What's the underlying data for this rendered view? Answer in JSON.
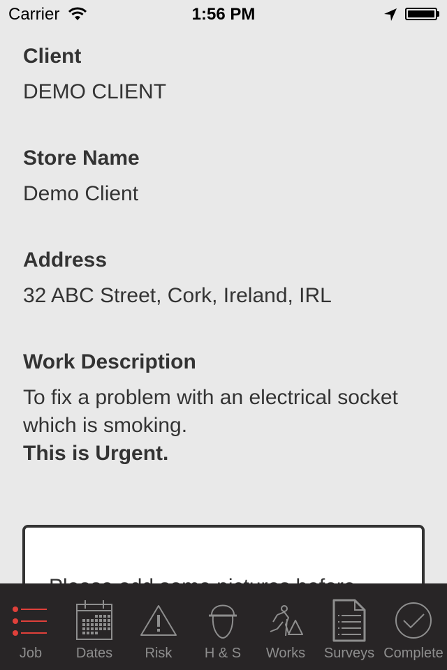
{
  "status_bar": {
    "carrier": "Carrier",
    "time": "1:56 PM",
    "icons": [
      "wifi-icon",
      "location-arrow-icon",
      "battery-icon"
    ]
  },
  "fields": [
    {
      "label": "Client",
      "value": "DEMO CLIENT"
    },
    {
      "label": "Store Name",
      "value": "Demo Client"
    },
    {
      "label": "Address",
      "value": "32 ABC Street, Cork, Ireland, IRL"
    },
    {
      "label": "Work Description",
      "value": "To fix a problem with an electrical socket which is smoking.",
      "emphasis": "This is Urgent."
    }
  ],
  "photo_prompt": "Please add some pictures before",
  "tab_bar": {
    "active_color": "#e0403a",
    "inactive_color": "#8e8e8e",
    "active_index": 0,
    "tabs": [
      {
        "label": "Job",
        "icon": "list-icon"
      },
      {
        "label": "Dates",
        "icon": "calendar-icon"
      },
      {
        "label": "Risk",
        "icon": "warning-icon"
      },
      {
        "label": "H & S",
        "icon": "hard-hat-head-icon"
      },
      {
        "label": "Works",
        "icon": "worker-digging-icon"
      },
      {
        "label": "Surveys",
        "icon": "document-icon"
      },
      {
        "label": "Complete",
        "icon": "checkmark-circle-icon"
      }
    ]
  }
}
